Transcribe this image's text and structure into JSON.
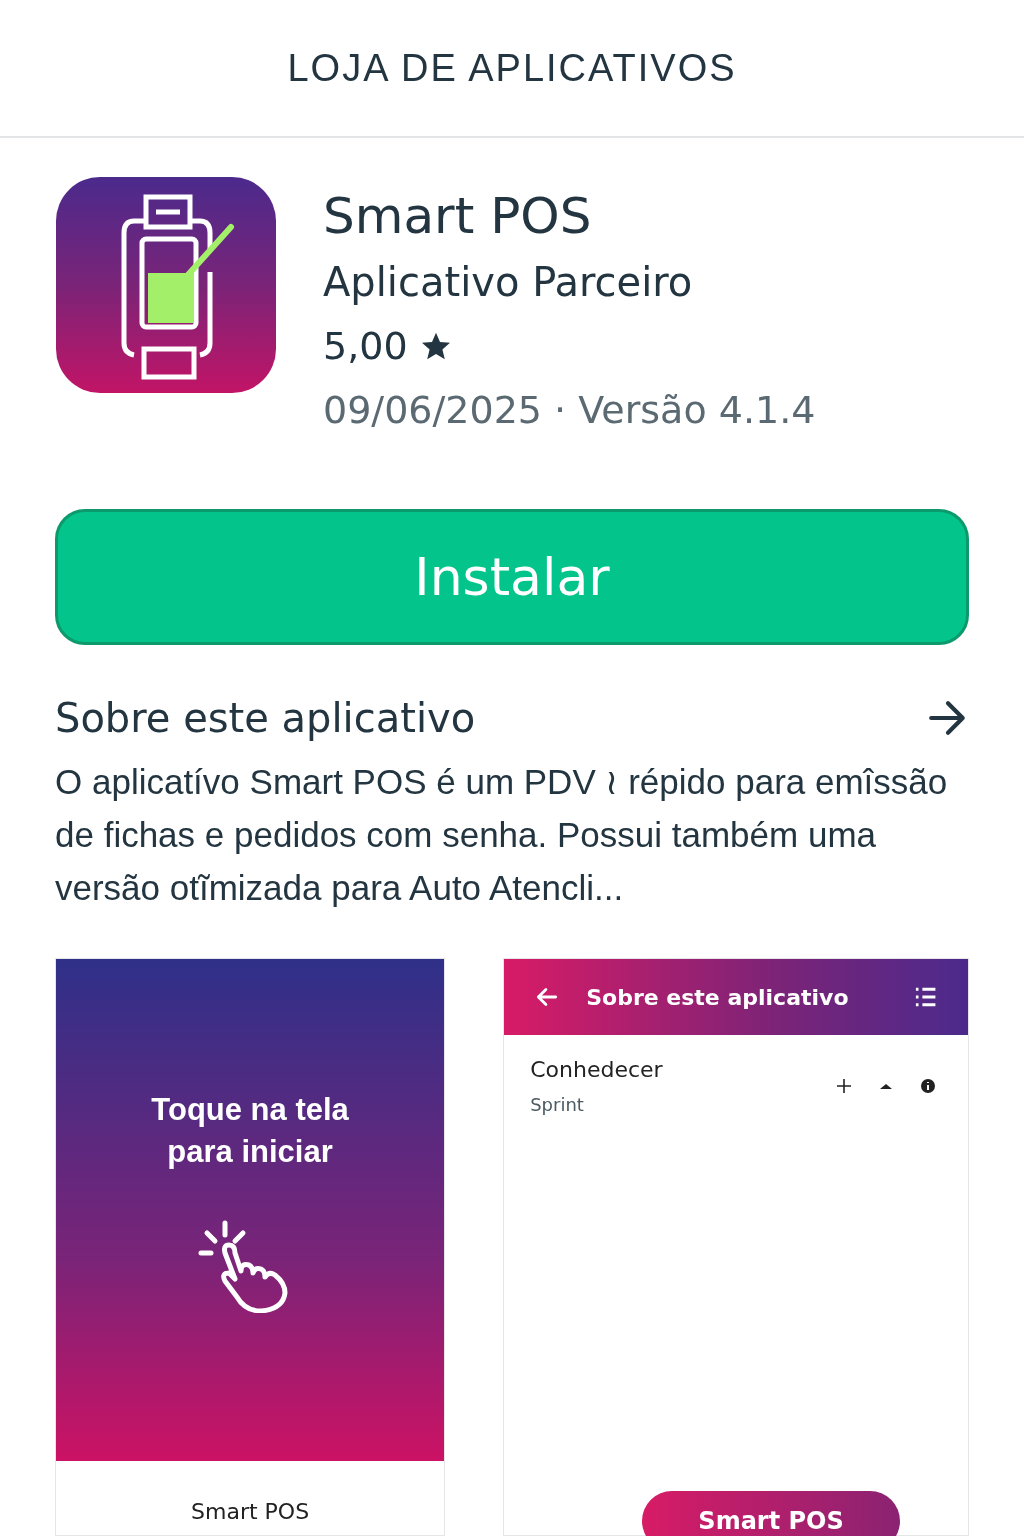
{
  "header": {
    "title": "LOJA DE APLICATIVOS"
  },
  "app": {
    "name": "Smart POS",
    "developer": "Aplicativo Parceiro",
    "rating": "5,00",
    "date_version": "09/06/2025 · Versão 4.1.4"
  },
  "install_button": {
    "label": "Instalar"
  },
  "about": {
    "heading": "Sobre este aplicativo",
    "description": "O aplicatívo Smart POS é um PDV ≀ répido para emîssão de fichas e pedidos com senha. Possui também uma versão otĩmizada para Auto Atencli..."
  },
  "screenshots": [
    {
      "kind": "splash",
      "message": "Toque na tela para iniciar",
      "caption": "Smart POS"
    },
    {
      "kind": "detail",
      "toolbar_title": "Sobre este aplicativo",
      "item_title": "Conhedecer",
      "item_subtitle": "Sprint",
      "button": "Smart POS"
    }
  ]
}
